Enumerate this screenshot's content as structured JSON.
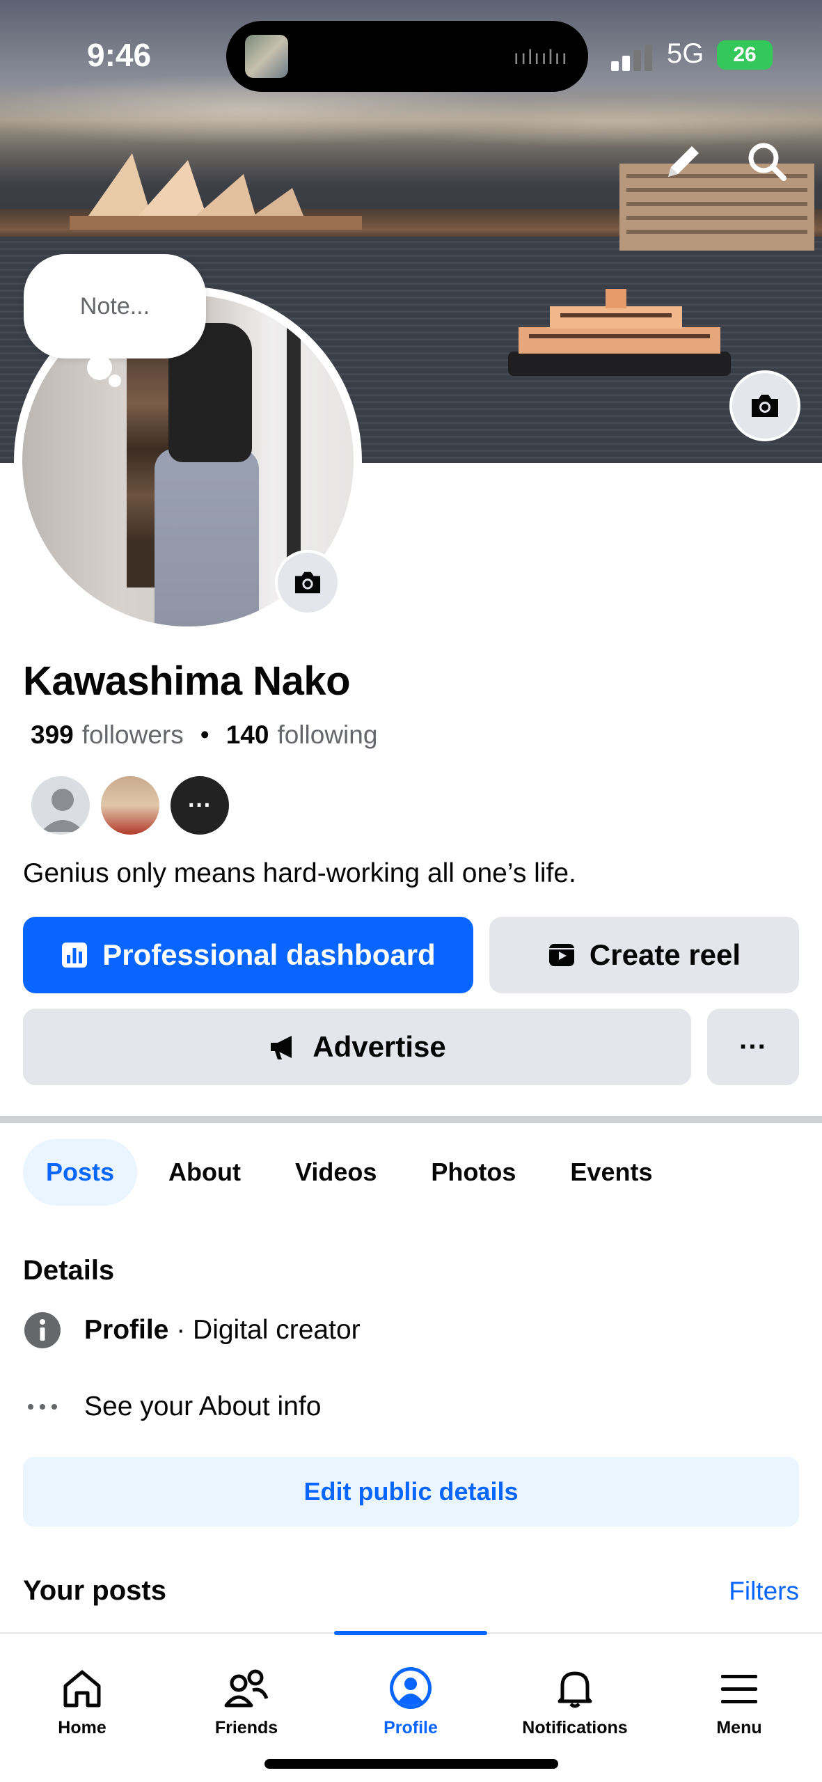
{
  "status_bar": {
    "time": "9:46",
    "network": "5G",
    "battery": "26"
  },
  "cover": {
    "edit_icon": "pencil-icon",
    "search_icon": "search-icon",
    "camera_icon": "camera-icon"
  },
  "note": {
    "placeholder": "Note..."
  },
  "profile": {
    "name": "Kawashima Nako",
    "followers_count": "399",
    "followers_label": "followers",
    "following_count": "140",
    "following_label": "following",
    "more_friends_label": "···",
    "bio": "Genius only means hard-working all one’s life."
  },
  "actions": {
    "dashboard": "Professional dashboard",
    "create_reel": "Create reel",
    "advertise": "Advertise",
    "more": "···"
  },
  "tabs": [
    "Posts",
    "About",
    "Videos",
    "Photos",
    "Events"
  ],
  "details": {
    "title": "Details",
    "profile_label": "Profile",
    "profile_value": " · Digital creator",
    "about_link": "See your About info",
    "edit_button": "Edit public details"
  },
  "posts": {
    "title": "Your posts",
    "filters": "Filters"
  },
  "bottom_nav": {
    "home": "Home",
    "friends": "Friends",
    "profile": "Profile",
    "notifications": "Notifications",
    "menu": "Menu"
  },
  "colors": {
    "primary": "#0866ff",
    "button_gray": "#e4e6eb",
    "light_blue": "#ebf5ff",
    "secondary_text": "#65676b"
  }
}
